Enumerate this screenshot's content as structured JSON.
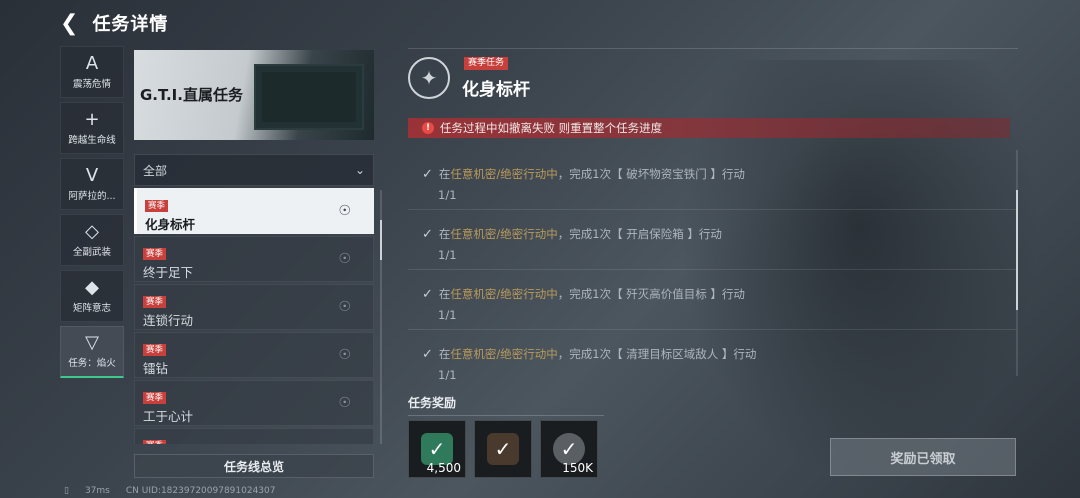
{
  "header": {
    "back_icon": "chevron-left-icon",
    "title": "任务详情"
  },
  "categories": [
    {
      "icon": "A",
      "label": "震荡危情"
    },
    {
      "icon": "+",
      "label": "跨越生命线"
    },
    {
      "icon": "V",
      "label": "阿萨拉的..."
    },
    {
      "icon": "◇",
      "label": "全副武装"
    },
    {
      "icon": "◆",
      "label": "矩阵意志"
    },
    {
      "icon": "▽",
      "label": "任务：焰火"
    }
  ],
  "banner": {
    "title": "G.T.I.直属任务"
  },
  "filter": {
    "value": "全部"
  },
  "tasks": [
    {
      "badge": "赛季",
      "name": "化身标杆"
    },
    {
      "badge": "赛季",
      "name": "终于足下"
    },
    {
      "badge": "赛季",
      "name": "连锁行动"
    },
    {
      "badge": "赛季",
      "name": "镭钻"
    },
    {
      "badge": "赛季",
      "name": "工于心计"
    },
    {
      "badge": "赛季",
      "name": ""
    }
  ],
  "overview_label": "任务线总览",
  "status": {
    "ping": "37ms",
    "uid": "CN UID:18239720097891024307"
  },
  "detail": {
    "season_badge": "赛季任务",
    "title": "化身标杆",
    "warning": "任务过程中如撤离失败 则重置整个任务进度",
    "objectives": [
      {
        "pre": "在",
        "mode": "任意机密/绝密行动中",
        "text": "，完成1次【 破坏物资宝铁门 】行动",
        "progress": "1/1"
      },
      {
        "pre": "在",
        "mode": "任意机密/绝密行动中",
        "text": "，完成1次【 开启保险箱 】行动",
        "progress": "1/1"
      },
      {
        "pre": "在",
        "mode": "任意机密/绝密行动中",
        "text": "，完成1次【 歼灭高价值目标 】行动",
        "progress": "1/1"
      },
      {
        "pre": "在",
        "mode": "任意机密/绝密行动中",
        "text": "，完成1次【 清理目标区域敌人 】行动",
        "progress": "1/1"
      }
    ],
    "rewards_label": "任务奖励",
    "rewards": [
      {
        "qty": "4,500",
        "color": "#2e7a5a"
      },
      {
        "qty": "",
        "color": "#4a3a2e"
      },
      {
        "qty": "150K",
        "color": "#5a5f64"
      }
    ],
    "claim_label": "奖励已领取"
  }
}
